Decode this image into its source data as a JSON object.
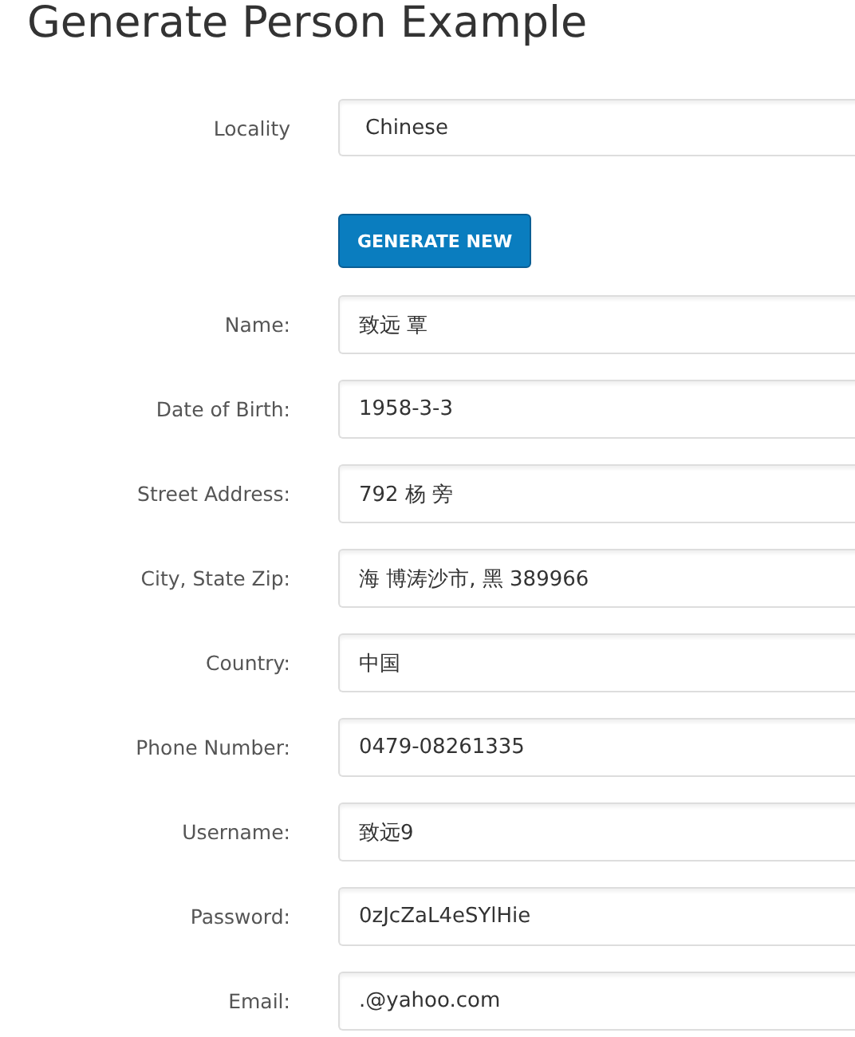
{
  "title": "Generate Person Example",
  "locality": {
    "label": "Locality",
    "value": "Chinese"
  },
  "generate_button": "GENERATE NEW",
  "fields": [
    {
      "label": "Name:",
      "value": "致远 覃"
    },
    {
      "label": "Date of Birth:",
      "value": "1958-3-3"
    },
    {
      "label": "Street Address:",
      "value": "792 杨 旁"
    },
    {
      "label": "City, State Zip:",
      "value": "海 博涛沙市, 黑 389966"
    },
    {
      "label": "Country:",
      "value": "中国"
    },
    {
      "label": "Phone Number:",
      "value": "0479-08261335"
    },
    {
      "label": "Username:",
      "value": "致远9"
    },
    {
      "label": "Password:",
      "value": "0zJcZaL4eSYlHie"
    },
    {
      "label": "Email:",
      "value": ".@yahoo.com"
    }
  ]
}
